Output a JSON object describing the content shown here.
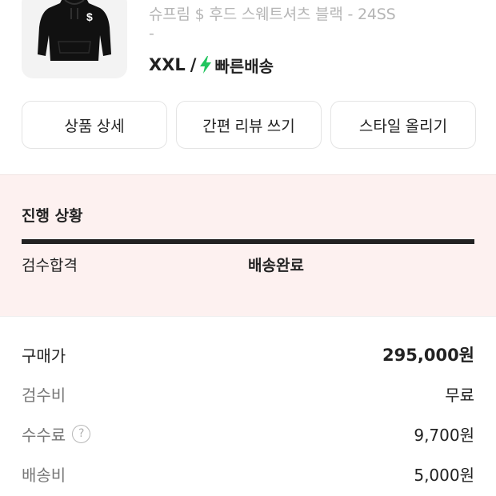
{
  "product": {
    "image_icon": "hoodie-image",
    "name": "슈프림 $ 후드 스웨트셔츠 블랙 - 24SS",
    "name_cont": "-",
    "size": "XXL",
    "separator": "/",
    "shipping_icon": "lightning-bolt-icon",
    "shipping_color": "#22c55e",
    "shipping_label": "빠른배송"
  },
  "actions": [
    {
      "label": "상품 상세"
    },
    {
      "label": "간편 리뷰 쓰기"
    },
    {
      "label": "스타일 올리기"
    }
  ],
  "progress": {
    "title": "진행 상황",
    "background": "#fdf1f0",
    "steps": [
      {
        "label": "검수합격",
        "active": false
      },
      {
        "label": "배송완료",
        "active": true
      }
    ],
    "completion": 1.0
  },
  "prices": [
    {
      "label": "구매가",
      "value": "295,000원"
    },
    {
      "label": "검수비",
      "value": "무료"
    },
    {
      "label": "수수료",
      "value": "9,700원",
      "help_icon": "?"
    },
    {
      "label": "배송비",
      "value": "5,000원"
    }
  ]
}
